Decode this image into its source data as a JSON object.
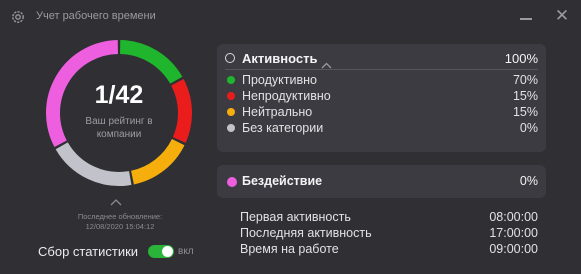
{
  "app": {
    "title": "Учет рабочего времени",
    "icon": "gear-icon"
  },
  "window": {
    "minimize_icon": "minimize-icon",
    "close_icon": "close-icon",
    "close_glyph": "✕"
  },
  "rating": {
    "rank": "1/42",
    "label": "Ваш рейтинг в компании",
    "ring_segments": [
      {
        "color": "#1fb52d",
        "fraction": 0.17
      },
      {
        "color": "#ea1c1c",
        "fraction": 0.15
      },
      {
        "color": "#f5ae0c",
        "fraction": 0.15
      },
      {
        "color": "#c2c2ca",
        "fraction": 0.2
      },
      {
        "color": "#ee5fe0",
        "fraction": 0.33
      }
    ]
  },
  "update": {
    "label": "Последнее обновление:",
    "timestamp": "12/08/2020 15:04:12"
  },
  "stats": {
    "label": "Сбор статистики",
    "enabled": true,
    "state": "вкл"
  },
  "activity": {
    "label": "Активность",
    "value": "100%",
    "rows": [
      {
        "label": "Продуктивно",
        "value": "70%",
        "color": "#1fb52d"
      },
      {
        "label": "Непродуктивно",
        "value": "15%",
        "color": "#ea1c1c"
      },
      {
        "label": "Нейтрально",
        "value": "15%",
        "color": "#f5ae0c"
      },
      {
        "label": "Без категории",
        "value": "0%",
        "color": "#c2c2ca"
      }
    ]
  },
  "idle": {
    "label": "Бездействие",
    "value": "0%",
    "color": "#ee5fe0"
  },
  "times": [
    {
      "label": "Первая активность",
      "value": "08:00:00"
    },
    {
      "label": "Последняя активность",
      "value": "17:00:00"
    },
    {
      "label": "Время на работе",
      "value": "09:00:00"
    }
  ]
}
